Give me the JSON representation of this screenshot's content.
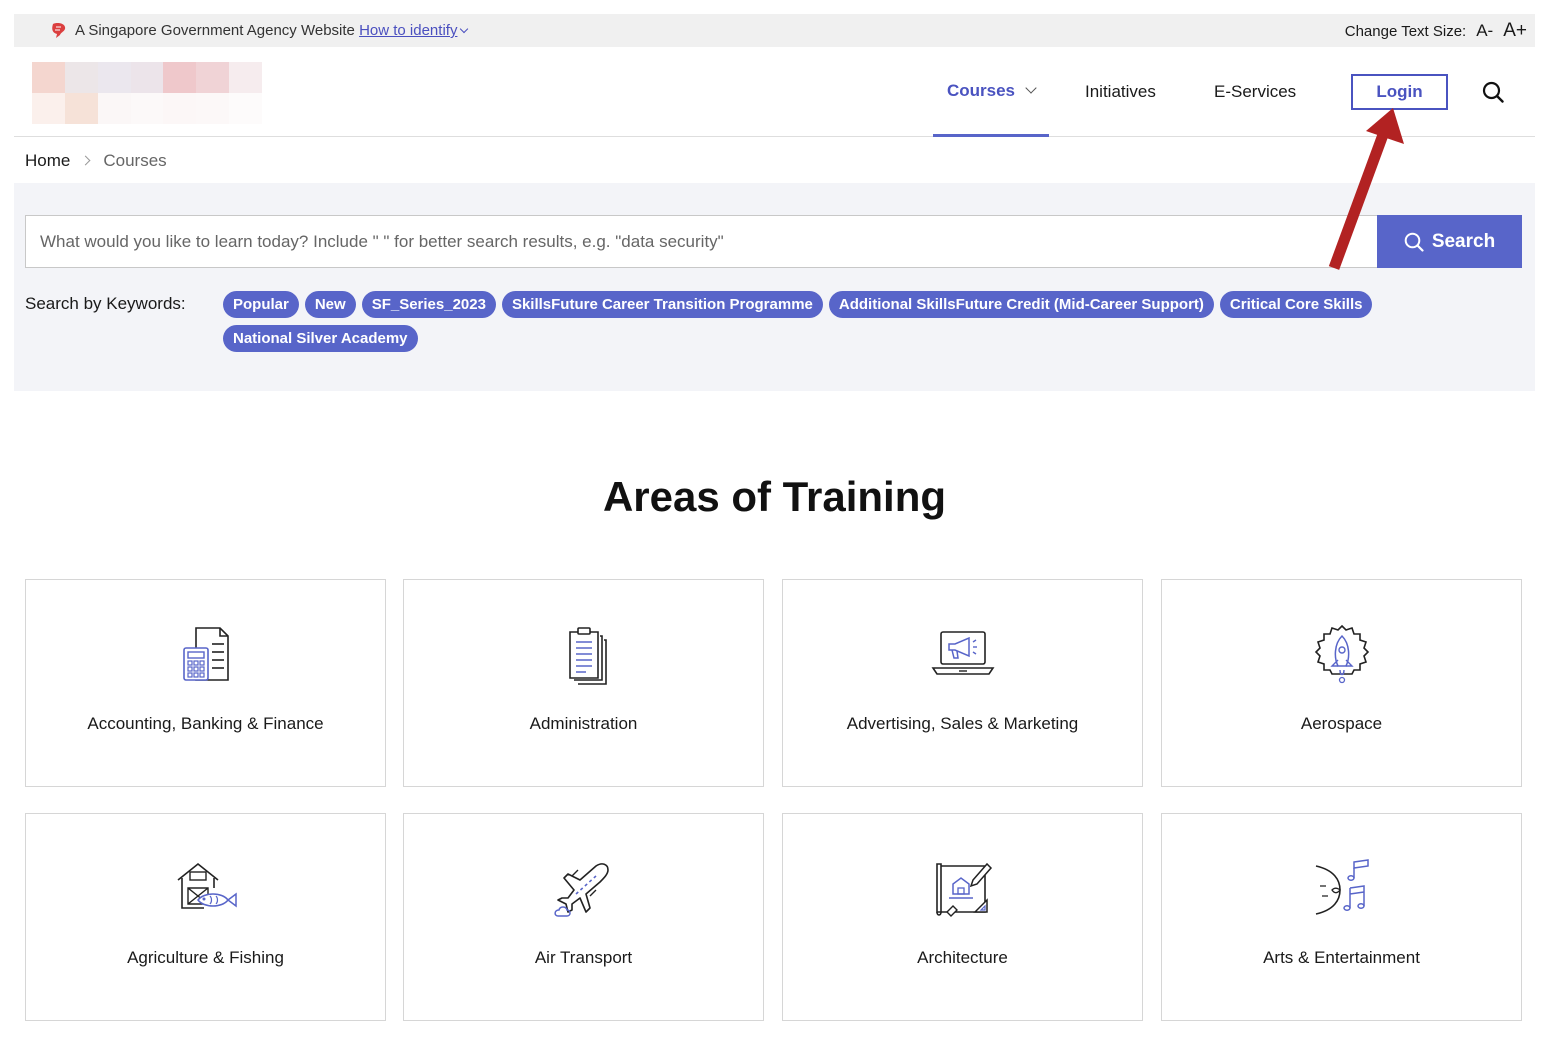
{
  "gov_bar": {
    "agency_text": "A Singapore Government Agency Website ",
    "identify_link": "How to identify",
    "text_size_label": "Change Text Size:",
    "decrease_label": "A-",
    "increase_label": "A+"
  },
  "nav": {
    "courses": "Courses",
    "initiatives": "Initiatives",
    "eservices": "E-Services",
    "login": "Login"
  },
  "breadcrumb": {
    "home": "Home",
    "current": "Courses"
  },
  "search": {
    "placeholder": "What would you like to learn today? Include \" \" for better search results, e.g. \"data security\"",
    "button": "Search",
    "keywords_label": "Search by Keywords:",
    "keywords": [
      "Popular",
      "New",
      "SF_Series_2023",
      "SkillsFuture Career Transition Programme",
      "Additional SkillsFuture Credit (Mid-Career Support)",
      "Critical Core Skills",
      "National Silver Academy"
    ]
  },
  "areas": {
    "title": "Areas of Training",
    "items": [
      {
        "label": "Accounting, Banking & Finance",
        "icon": "calculator-document-icon"
      },
      {
        "label": "Administration",
        "icon": "documents-icon"
      },
      {
        "label": "Advertising, Sales & Marketing",
        "icon": "laptop-megaphone-icon"
      },
      {
        "label": "Aerospace",
        "icon": "rocket-gear-icon"
      },
      {
        "label": "Agriculture & Fishing",
        "icon": "barn-fish-icon"
      },
      {
        "label": "Air Transport",
        "icon": "airplane-icon"
      },
      {
        "label": "Architecture",
        "icon": "blueprint-icon"
      },
      {
        "label": "Arts & Entertainment",
        "icon": "music-notes-icon"
      }
    ]
  },
  "colors": {
    "accent": "#5865c9",
    "annotation_arrow": "#b22222"
  }
}
